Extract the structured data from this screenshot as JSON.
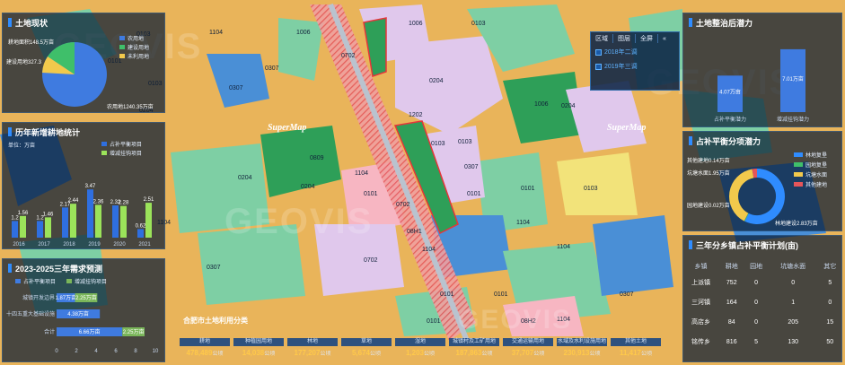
{
  "colors": {
    "accent": "#2f8cff",
    "gold": "#ffc94a",
    "green": "#3fbf6a",
    "purple": "#e0c8ec",
    "red_hatch": "#e5555a"
  },
  "watermark": {
    "brand": "GEOVIS",
    "supermap": "SuperMap"
  },
  "map": {
    "parcel_codes": [
      "1104",
      "0307",
      "0103",
      "1006",
      "0204",
      "1006",
      "0103",
      "0103",
      "0307",
      "0702",
      "1202",
      "0809",
      "1104",
      "0204",
      "0101",
      "0103",
      "1104",
      "0204",
      "0307",
      "0101",
      "0101",
      "0103",
      "1104",
      "0101",
      "08H1",
      "0702",
      "0101",
      "1104",
      "0204",
      "0307",
      "1104",
      "0101",
      "0103",
      "0204",
      "1006",
      "0702",
      "0101",
      "1104",
      "0307",
      "08H2"
    ]
  },
  "layer_switcher": {
    "tabs": [
      "区域",
      "图层",
      "全屏"
    ],
    "layers": [
      "2018年二调",
      "2019年三调"
    ]
  },
  "panel_land_status": {
    "title": "土地现状",
    "pie_labels": [
      "耕地面积148.5万亩",
      "建设用地327.3",
      "农用地1240.35万亩"
    ],
    "legend": [
      "农用地",
      "建设用地",
      "未利用地"
    ],
    "legend_colors": [
      "#3f7be0",
      "#3fbf6a",
      "#f2c94c"
    ],
    "pie_values": [
      1240.35,
      327.3,
      148.5
    ]
  },
  "panel_yearly": {
    "title": "历年新增耕地统计",
    "unit": "单位：万亩",
    "legend": [
      "占补平衡项目",
      "增减挂钩项目"
    ],
    "chart_data": {
      "type": "bar",
      "categories": [
        "2016",
        "2017",
        "2018",
        "2019",
        "2020",
        "2021"
      ],
      "series": [
        {
          "name": "占补平衡项目",
          "values": [
            1.2,
            1.2,
            2.17,
            3.47,
            2.32,
            0.62
          ]
        },
        {
          "name": "增减挂钩项目",
          "values": [
            1.56,
            1.46,
            2.44,
            2.36,
            2.28,
            2.51
          ]
        }
      ],
      "ylim": [
        0,
        4
      ]
    }
  },
  "panel_plan": {
    "title": "2023-2025三年需求预测",
    "legend": [
      "占补平衡项目",
      "增减挂钩项目"
    ],
    "chart_data": {
      "type": "bar",
      "categories": [
        "城镇开发边界",
        "十四五重大基础设施",
        "合计"
      ],
      "series": [
        {
          "name": "占补平衡项目",
          "values": [
            1.87,
            4.38,
            6.66
          ]
        },
        {
          "name": "增减挂钩项目",
          "values": [
            2.25,
            0,
            2.25
          ]
        }
      ],
      "value_labels": [
        "1.87万亩",
        "2.25万亩",
        "4.38万亩",
        "6.66万亩",
        "2.25万亩"
      ],
      "xticks": [
        "0",
        "2",
        "4",
        "6",
        "8",
        "10"
      ],
      "xlim": [
        0,
        10
      ]
    }
  },
  "panel_potential": {
    "title": "土地整治后潜力",
    "chart_data": {
      "type": "bar",
      "categories": [
        "占补平衡潜力",
        "增减挂钩潜力"
      ],
      "values": [
        4.07,
        7.01
      ],
      "value_labels": [
        "4.07万亩",
        "7.01万亩"
      ]
    }
  },
  "panel_balance": {
    "title": "占补平衡分项潜力",
    "donut_labels": [
      "其他建地0.14万亩",
      "坑塘水面1.95万亩",
      "园地建设0.02万亩",
      "林地建设2.83万亩"
    ],
    "legend": [
      "林地复垦",
      "园地复垦",
      "坑塘水面",
      "其他建地"
    ],
    "legend_colors": [
      "#2f8cff",
      "#3fbf6a",
      "#f2c94c",
      "#e5555a"
    ],
    "chart_data": {
      "type": "pie",
      "values": [
        2.83,
        0.02,
        1.95,
        0.14
      ]
    }
  },
  "panel_table": {
    "title": "三年分乡镇占补平衡计划(亩)",
    "headers": [
      "乡镇",
      "耕地",
      "园地",
      "坑塘水面",
      "其它"
    ],
    "rows": [
      [
        "上派镇",
        "752",
        "0",
        "0",
        "5"
      ],
      [
        "三河镇",
        "164",
        "0",
        "1",
        "0"
      ],
      [
        "高店乡",
        "84",
        "0",
        "205",
        "15"
      ],
      [
        "铭传乡",
        "816",
        "5",
        "130",
        "50"
      ]
    ]
  },
  "bottom": {
    "title": "合肥市土地利用分类",
    "unit": "公顷",
    "items": [
      {
        "label": "耕地",
        "value": "478,489"
      },
      {
        "label": "种植园用地",
        "value": "14,038"
      },
      {
        "label": "林地",
        "value": "177,207"
      },
      {
        "label": "草地",
        "value": "5,674"
      },
      {
        "label": "湿地",
        "value": "1,203"
      },
      {
        "label": "城镇村及工矿用地",
        "value": "187,863"
      },
      {
        "label": "交通运输用地",
        "value": "37,707"
      },
      {
        "label": "水域及水利设施用地",
        "value": "230,913"
      },
      {
        "label": "其他土地",
        "value": "11,417"
      }
    ]
  }
}
